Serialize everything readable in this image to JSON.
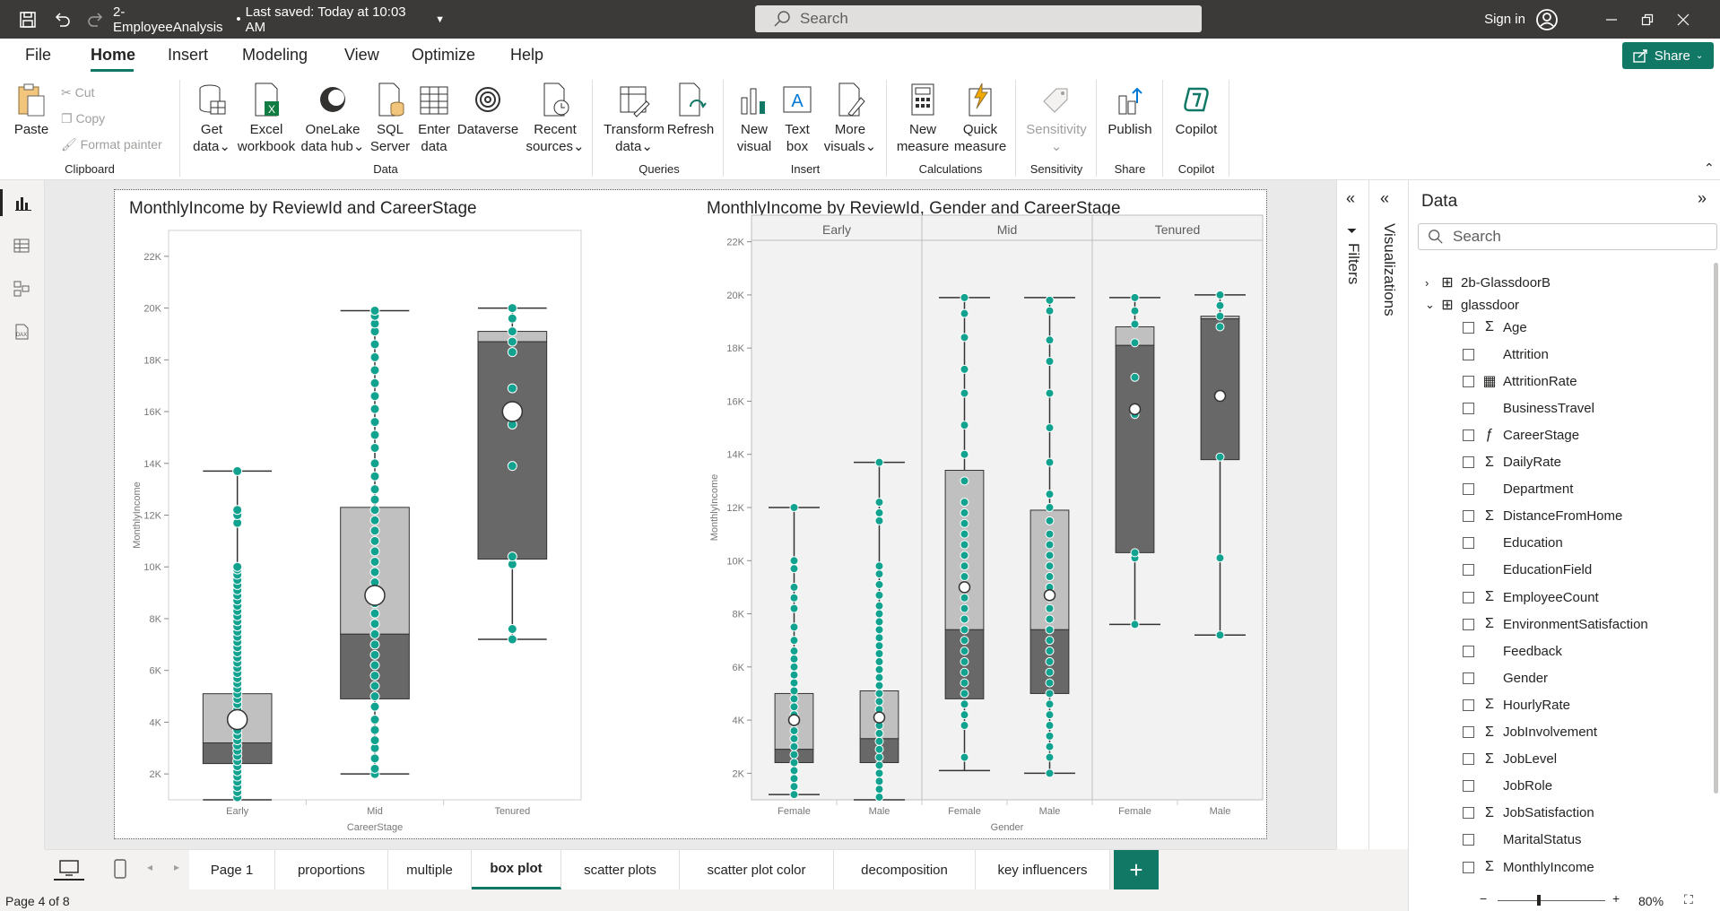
{
  "titlebar": {
    "file_title": "2-EmployeeAnalysis",
    "saved": "Last saved: Today at 10:03 AM",
    "search_placeholder": "Search",
    "sign_in": "Sign in"
  },
  "menu": {
    "items": [
      "File",
      "Home",
      "Insert",
      "Modeling",
      "View",
      "Optimize",
      "Help"
    ],
    "active": "Home",
    "share": "Share"
  },
  "ribbon": {
    "clipboard": {
      "paste": "Paste",
      "cut": "Cut",
      "copy": "Copy",
      "format_painter": "Format painter",
      "group": "Clipboard"
    },
    "data": {
      "buttons": [
        {
          "l1": "Get",
          "l2": "data",
          "dd": true
        },
        {
          "l1": "Excel",
          "l2": "workbook",
          "dd": false
        },
        {
          "l1": "OneLake",
          "l2": "data hub",
          "dd": true
        },
        {
          "l1": "SQL",
          "l2": "Server",
          "dd": false
        },
        {
          "l1": "Enter",
          "l2": "data",
          "dd": false
        },
        {
          "l1": "Dataverse",
          "l2": "",
          "dd": false
        },
        {
          "l1": "Recent",
          "l2": "sources",
          "dd": true
        }
      ],
      "group": "Data"
    },
    "queries": {
      "transform_l1": "Transform",
      "transform_l2": "data",
      "refresh": "Refresh",
      "group": "Queries"
    },
    "insert": {
      "new_visual_l1": "New",
      "new_visual_l2": "visual",
      "text_box_l1": "Text",
      "text_box_l2": "box",
      "more_visuals_l1": "More",
      "more_visuals_l2": "visuals",
      "group": "Insert"
    },
    "calculations": {
      "new_measure_l1": "New",
      "new_measure_l2": "measure",
      "quick_measure_l1": "Quick",
      "quick_measure_l2": "measure",
      "group": "Calculations"
    },
    "sensitivity": {
      "label": "Sensitivity",
      "group": "Sensitivity"
    },
    "share": {
      "publish": "Publish",
      "group": "Share"
    },
    "copilot": {
      "label": "Copilot",
      "group": "Copilot"
    }
  },
  "panes": {
    "filters": "Filters",
    "visualizations": "Visualizations",
    "data_title": "Data",
    "data_search_placeholder": "Search"
  },
  "data_fields": {
    "tables": [
      "2b-GlassdoorB",
      "glassdoor"
    ],
    "fields": [
      {
        "name": "Age",
        "icon": "sum"
      },
      {
        "name": "Attrition",
        "icon": ""
      },
      {
        "name": "AttritionRate",
        "icon": "calc"
      },
      {
        "name": "BusinessTravel",
        "icon": ""
      },
      {
        "name": "CareerStage",
        "icon": "calc-col"
      },
      {
        "name": "DailyRate",
        "icon": "sum"
      },
      {
        "name": "Department",
        "icon": ""
      },
      {
        "name": "DistanceFromHome",
        "icon": "sum"
      },
      {
        "name": "Education",
        "icon": ""
      },
      {
        "name": "EducationField",
        "icon": ""
      },
      {
        "name": "EmployeeCount",
        "icon": "sum"
      },
      {
        "name": "EnvironmentSatisfaction",
        "icon": "sum"
      },
      {
        "name": "Feedback",
        "icon": ""
      },
      {
        "name": "Gender",
        "icon": ""
      },
      {
        "name": "HourlyRate",
        "icon": "sum"
      },
      {
        "name": "JobInvolvement",
        "icon": "sum"
      },
      {
        "name": "JobLevel",
        "icon": "sum"
      },
      {
        "name": "JobRole",
        "icon": ""
      },
      {
        "name": "JobSatisfaction",
        "icon": "sum"
      },
      {
        "name": "MaritalStatus",
        "icon": ""
      },
      {
        "name": "MonthlyIncome",
        "icon": "sum"
      }
    ]
  },
  "page_tabs": {
    "tabs": [
      "Page 1",
      "proportions",
      "multiple",
      "box plot",
      "scatter plots",
      "scatter plot color",
      "decomposition",
      "key influencers"
    ],
    "active": "box plot"
  },
  "status": {
    "page": "Page 4 of 8",
    "zoom": "80%"
  },
  "colors": {
    "dot": "#11a38f",
    "box_dark": "#686868",
    "box_light": "#c0c0c0"
  },
  "chart_data": [
    {
      "type": "box",
      "title": "MonthlyIncome by ReviewId and CareerStage",
      "xlabel": "CareerStage",
      "ylabel": "MonthlyIncome",
      "yticks": [
        "2K",
        "4K",
        "6K",
        "8K",
        "10K",
        "12K",
        "14K",
        "16K",
        "18K",
        "20K",
        "22K"
      ],
      "ylim": [
        1000,
        23000
      ],
      "categories": [
        "Early",
        "Mid",
        "Tenured"
      ],
      "boxes": [
        {
          "min": 1000,
          "q1": 2400,
          "median": 3200,
          "q3": 5100,
          "max": 13700,
          "mean": 4100,
          "points": [
            1100,
            1300,
            1500,
            1700,
            1900,
            2100,
            2300,
            2500,
            2700,
            2900,
            3100,
            3300,
            3500,
            3700,
            3900,
            4100,
            4300,
            4500,
            4700,
            4900,
            5100,
            5300,
            5500,
            5700,
            5900,
            6100,
            6300,
            6500,
            6700,
            6900,
            7100,
            7300,
            7500,
            7700,
            7900,
            8100,
            8300,
            8500,
            8700,
            8900,
            9100,
            9300,
            9500,
            9700,
            9900,
            10000,
            11700,
            12000,
            12200,
            13700
          ]
        },
        {
          "min": 2000,
          "q1": 4900,
          "median": 7400,
          "q3": 12300,
          "max": 19900,
          "mean": 8900,
          "points": [
            2000,
            2200,
            2600,
            3000,
            3300,
            3700,
            4100,
            4600,
            5000,
            5400,
            5800,
            6200,
            6600,
            7000,
            7400,
            7800,
            8200,
            8600,
            9000,
            9400,
            9800,
            10200,
            10600,
            11000,
            11400,
            11800,
            12200,
            12600,
            13000,
            13500,
            14000,
            14600,
            15100,
            15600,
            16100,
            16600,
            17100,
            17600,
            18100,
            18600,
            19100,
            19400,
            19700,
            19900
          ]
        },
        {
          "min": 7200,
          "q1": 10300,
          "median": 18700,
          "q3": 19100,
          "max": 20000,
          "mean": 16000,
          "points": [
            7200,
            7600,
            10100,
            10400,
            13900,
            15500,
            16900,
            18300,
            18700,
            19100,
            19600,
            20000
          ]
        }
      ]
    },
    {
      "type": "box",
      "title": "MonthlyIncome by ReviewId, Gender and CareerStage",
      "xlabel": "Gender",
      "ylabel": "MonthlyIncome",
      "yticks": [
        "2K",
        "4K",
        "6K",
        "8K",
        "10K",
        "12K",
        "14K",
        "16K",
        "18K",
        "20K",
        "22K"
      ],
      "ylim": [
        1000,
        23000
      ],
      "panels": [
        "Early",
        "Mid",
        "Tenured"
      ],
      "categories": [
        "Female",
        "Male",
        "Female",
        "Male",
        "Female",
        "Male"
      ],
      "boxes": [
        {
          "min": 1200,
          "q1": 2400,
          "median": 2900,
          "q3": 5000,
          "max": 12000,
          "mean": 4000,
          "points": [
            1200,
            1500,
            1800,
            2100,
            2400,
            2700,
            3000,
            3300,
            3600,
            3900,
            4200,
            4500,
            4800,
            5100,
            5400,
            5700,
            6000,
            6300,
            6600,
            7000,
            7500,
            8200,
            8600,
            9000,
            9700,
            10000,
            12000
          ]
        },
        {
          "min": 1000,
          "q1": 2400,
          "median": 3300,
          "q3": 5100,
          "max": 13700,
          "mean": 4100,
          "points": [
            1100,
            1400,
            1700,
            2000,
            2300,
            2600,
            2900,
            3200,
            3500,
            3800,
            4100,
            4400,
            4700,
            5000,
            5300,
            5600,
            5900,
            6200,
            6500,
            6800,
            7100,
            7400,
            7700,
            8000,
            8300,
            8700,
            9100,
            9500,
            9800,
            11500,
            11800,
            12200,
            13700
          ]
        },
        {
          "min": 2100,
          "q1": 4800,
          "median": 7400,
          "q3": 13400,
          "max": 19900,
          "mean": 9000,
          "points": [
            2600,
            3800,
            4200,
            4600,
            5000,
            5400,
            5800,
            6200,
            6600,
            7000,
            7400,
            7800,
            8200,
            8600,
            9000,
            9400,
            9800,
            10200,
            10600,
            11000,
            11400,
            11800,
            12200,
            13000,
            14000,
            15100,
            16300,
            17200,
            18400,
            19300,
            19900
          ]
        },
        {
          "min": 2000,
          "q1": 5000,
          "median": 7400,
          "q3": 11900,
          "max": 19900,
          "mean": 8700,
          "points": [
            2000,
            2600,
            3000,
            3400,
            3800,
            4200,
            4600,
            5000,
            5400,
            5800,
            6200,
            6600,
            7000,
            7400,
            7800,
            8200,
            8600,
            9000,
            9400,
            9800,
            10200,
            10600,
            11000,
            11500,
            12000,
            12500,
            13700,
            15000,
            16300,
            17500,
            18300,
            19400,
            19800
          ]
        },
        {
          "min": 7600,
          "q1": 10300,
          "median": 18100,
          "q3": 18800,
          "max": 19900,
          "mean": 15700,
          "points": [
            7600,
            10100,
            10300,
            15500,
            16900,
            18200,
            18900,
            19400,
            19900
          ]
        },
        {
          "min": 7200,
          "q1": 13800,
          "median": 19100,
          "q3": 19200,
          "max": 20000,
          "mean": 16200,
          "points": [
            7200,
            10100,
            13900,
            18800,
            19200,
            19600,
            20000
          ]
        }
      ]
    }
  ]
}
